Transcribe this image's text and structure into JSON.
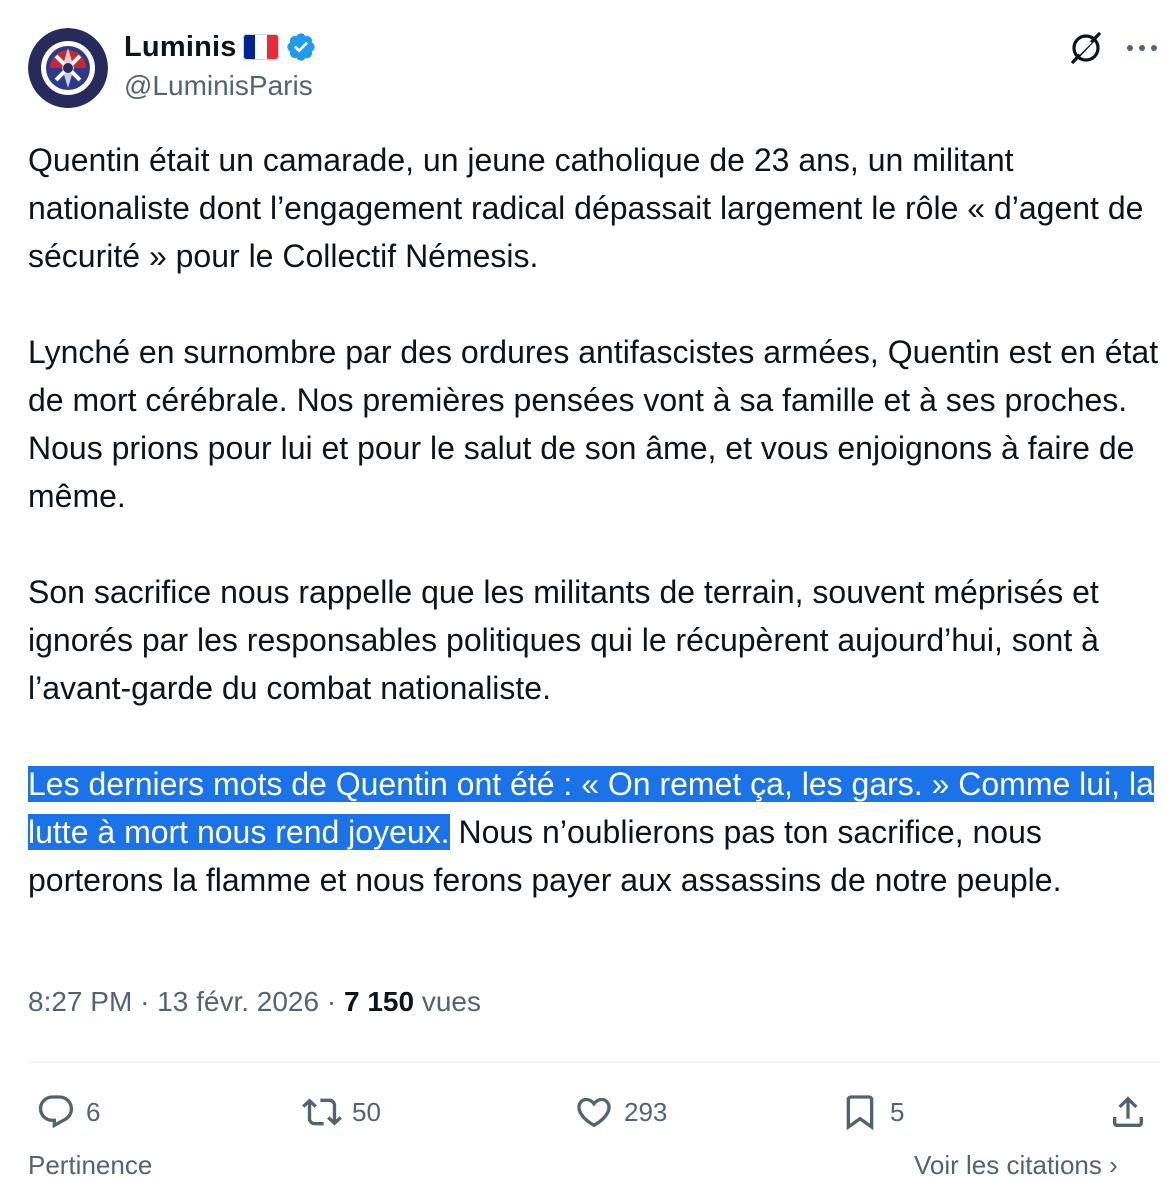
{
  "author": {
    "display_name": "Luminis",
    "handle": "@LuminisParis",
    "flag_icon": "france-flag-icon",
    "verified_icon": "verified-badge-icon"
  },
  "header": {
    "grok_icon": "grok-icon",
    "more_icon": "more-horizontal-icon"
  },
  "tweet": {
    "paragraph_1": "Quentin était un camarade, un jeune catholique de 23 ans, un militant nationaliste dont l’engagement radical dépassait largement le rôle « d’agent de sécurité » pour le Collectif Némesis.",
    "paragraph_2": "Lynché en surnombre par des ordures antifascistes armées, Quentin est en état de mort cérébrale. Nos premières pensées vont à sa famille et à ses proches. Nous prions pour lui et pour le salut de son âme, et vous enjoignons à faire de même.",
    "paragraph_3": "Son sacrifice nous rappelle que les militants de terrain, souvent méprisés et ignorés par les responsables politiques qui le récupèrent aujourd’hui, sont à l’avant-garde du combat nationaliste.",
    "paragraph_4_highlighted": "Les derniers mots de Quentin ont été : « On remet ça, les gars. » Comme lui, la lutte à mort nous rend joyeux.",
    "paragraph_4_rest": " Nous n’oublierons pas ton sacrifice, nous porterons la flamme et nous ferons payer aux assassins de notre peuple."
  },
  "meta": {
    "time": "8:27 PM",
    "separator": "·",
    "date": "13 févr. 2026",
    "views_count": "7 150",
    "views_label": "vues"
  },
  "actions": {
    "replies": "6",
    "reposts": "50",
    "likes": "293",
    "bookmarks": "5"
  },
  "bottom": {
    "left_tab": "Pertinence",
    "right_link": "Voir les citations ›"
  },
  "colors": {
    "highlight": "#1a73e8",
    "secondary_text": "#536471",
    "verified": "#1d9bf0"
  }
}
